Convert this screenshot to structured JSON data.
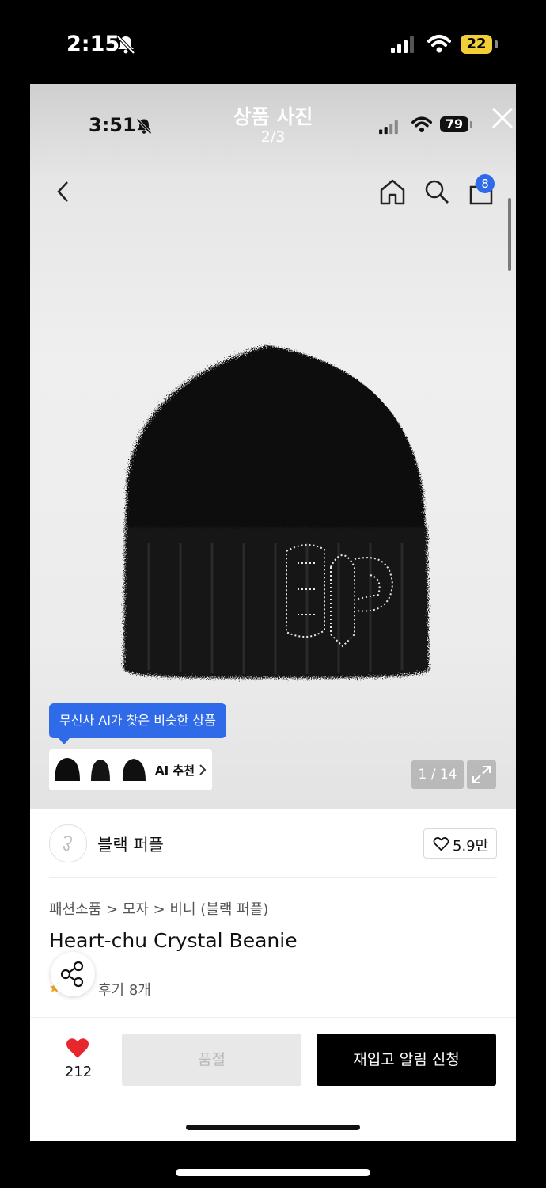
{
  "outer_status": {
    "time": "2:15",
    "battery": "22"
  },
  "inner_status": {
    "time": "3:51",
    "battery": "79"
  },
  "viewer": {
    "title": "상품 사진",
    "counter": "2/3"
  },
  "header": {
    "cart_count": "8"
  },
  "image_counter": "1 / 14",
  "ai": {
    "tooltip": "무신사 AI가 찾은 비슷한 상품",
    "label": "AI 추천"
  },
  "brand": {
    "name": "블랙 퍼플",
    "likes": "5.9만"
  },
  "product": {
    "breadcrumb": "패션소품 > 모자 > 비니 (블랙 퍼플)",
    "title": "Heart-chu Crystal Beanie",
    "reviews": "후기 8개"
  },
  "bottom": {
    "heart_count": "212",
    "soldout_label": "품절",
    "restock_label": "재입고 알림 신청"
  },
  "colors": {
    "accent": "#2f6be8",
    "heart": "#e8272d",
    "battery_low": "#f3cf37"
  }
}
